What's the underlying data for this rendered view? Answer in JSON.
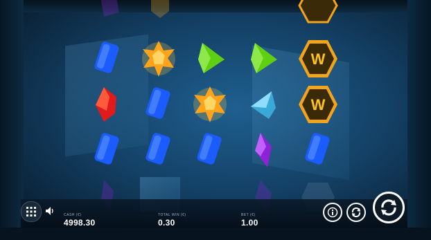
{
  "hud": {
    "cash_label": "CASH (€)",
    "cash_value": "4998.30",
    "total_win_label": "TOTAL WIN (€)",
    "total_win_value": "0.30",
    "bet_label": "BET (€)",
    "bet_value": "1.00"
  },
  "symbols": {
    "wild_letter": "W"
  },
  "reels": [
    [
      "blue-gem",
      "red-gem",
      "blue-gem"
    ],
    [
      "gold-star-gem",
      "blue-gem",
      "blue-gem"
    ],
    [
      "green-gem",
      "gold-star-gem",
      "blue-gem"
    ],
    [
      "green-gem",
      "cyan-gem",
      "purple-gem"
    ],
    [
      "wild",
      "wild",
      "blue-gem"
    ]
  ],
  "colors": {
    "blue_gem": "#1f6bff",
    "gold_gem": "#ffb21c",
    "green_gem": "#6ed51c",
    "red_gem": "#e81d1d",
    "cyan_gem": "#4fc3ea",
    "purple_gem": "#9b2be0",
    "wild_frame": "#f2a51a"
  },
  "icons": {
    "menu": "grid-menu-icon",
    "sound": "speaker-icon",
    "info": "info-icon",
    "autoplay": "autoplay-icon",
    "spin": "spin-icon"
  }
}
